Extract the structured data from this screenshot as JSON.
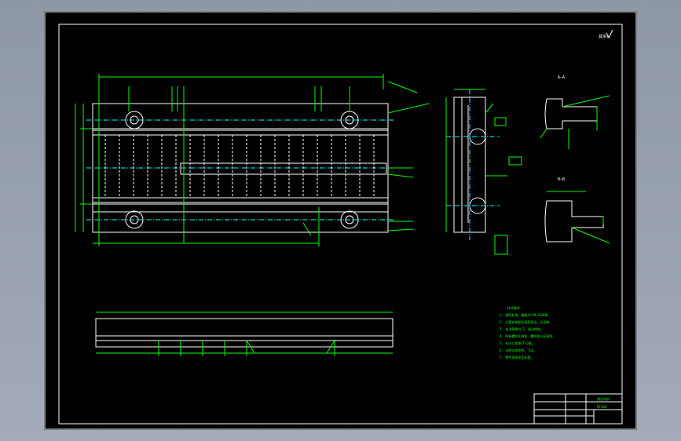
{
  "drawing": {
    "roughness_symbol": "其余√",
    "section_label_top": "A—A",
    "section_label_bottom": "B—B",
    "tech_requirements_title": "技术要求",
    "tech_requirements": [
      "1. 调质处理，硬度为220~250HB。",
      "2. 主要安装配合表面清洁，无毛刺。",
      "3. 未注倒角为C1，锐边倒钝。",
      "4. 所有螺纹孔倒角，螺纹部分无损伤。",
      "5. 未注公差按IT12级。",
      "6. 去除全部毛刺、飞边。",
      "7. 零件表面发蓝处理。"
    ],
    "title_block": {
      "drawing_name": "滑台导轨",
      "material": "HT200"
    }
  }
}
